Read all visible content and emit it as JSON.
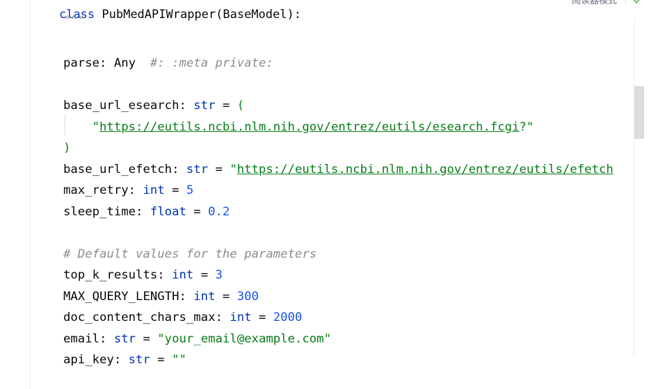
{
  "sticky_header": {
    "keyword": "class",
    "text": " PubMedAPIWrapper(BaseModel):"
  },
  "toolbar": {
    "reader_mode_label": "阅读器模式"
  },
  "lines": [
    {
      "parts": [
        {
          "t": "\"\"\"",
          "c": "cmt"
        }
      ]
    },
    {
      "parts": []
    },
    {
      "parts": [
        {
          "t": "parse: Any  ",
          "c": ""
        },
        {
          "t": "#: :meta private:",
          "c": "cmt"
        }
      ]
    },
    {
      "parts": []
    },
    {
      "parts": [
        {
          "t": "base_url_esearch: ",
          "c": ""
        },
        {
          "t": "str",
          "c": "kw"
        },
        {
          "t": " = ",
          "c": ""
        },
        {
          "t": "(",
          "c": "str"
        }
      ]
    },
    {
      "parts": [
        {
          "t": "    \"",
          "c": "str"
        },
        {
          "t": "https://eutils.ncbi.nlm.nih.gov/entrez/eutils/esearch.fcgi",
          "c": "url"
        },
        {
          "t": "?\"",
          "c": "str"
        }
      ]
    },
    {
      "parts": [
        {
          "t": ")",
          "c": "str"
        }
      ]
    },
    {
      "parts": [
        {
          "t": "base_url_efetch: ",
          "c": ""
        },
        {
          "t": "str",
          "c": "kw"
        },
        {
          "t": " = ",
          "c": ""
        },
        {
          "t": "\"",
          "c": "str"
        },
        {
          "t": "https://eutils.ncbi.nlm.nih.gov/entrez/eutils/efetch",
          "c": "url"
        }
      ]
    },
    {
      "parts": [
        {
          "t": "max_retry: ",
          "c": ""
        },
        {
          "t": "int",
          "c": "kw"
        },
        {
          "t": " = ",
          "c": ""
        },
        {
          "t": "5",
          "c": "num"
        }
      ]
    },
    {
      "parts": [
        {
          "t": "sleep_time: ",
          "c": ""
        },
        {
          "t": "float",
          "c": "kw"
        },
        {
          "t": " = ",
          "c": ""
        },
        {
          "t": "0.2",
          "c": "num"
        }
      ]
    },
    {
      "parts": []
    },
    {
      "parts": [
        {
          "t": "# Default values for the parameters",
          "c": "cmt"
        }
      ]
    },
    {
      "parts": [
        {
          "t": "top_k_results: ",
          "c": ""
        },
        {
          "t": "int",
          "c": "kw"
        },
        {
          "t": " = ",
          "c": ""
        },
        {
          "t": "3",
          "c": "num"
        }
      ]
    },
    {
      "parts": [
        {
          "t": "MAX_QUERY_LENGTH: ",
          "c": ""
        },
        {
          "t": "int",
          "c": "kw"
        },
        {
          "t": " = ",
          "c": ""
        },
        {
          "t": "300",
          "c": "num"
        }
      ]
    },
    {
      "parts": [
        {
          "t": "doc_content_chars_max: ",
          "c": ""
        },
        {
          "t": "int",
          "c": "kw"
        },
        {
          "t": " = ",
          "c": ""
        },
        {
          "t": "2000",
          "c": "num"
        }
      ]
    },
    {
      "parts": [
        {
          "t": "email: ",
          "c": ""
        },
        {
          "t": "str",
          "c": "kw"
        },
        {
          "t": " = ",
          "c": ""
        },
        {
          "t": "\"your_email@example.com\"",
          "c": "str"
        }
      ]
    },
    {
      "parts": [
        {
          "t": "api_key: ",
          "c": ""
        },
        {
          "t": "str",
          "c": "kw"
        },
        {
          "t": " = ",
          "c": ""
        },
        {
          "t": "\"\"",
          "c": "str"
        }
      ]
    }
  ],
  "colors": {
    "keyword": "#0033b3",
    "string": "#067d17",
    "number": "#1750eb",
    "comment": "#8c8c8c",
    "text": "#080808"
  },
  "icons": {
    "inspection_status": "check-shield-icon"
  }
}
